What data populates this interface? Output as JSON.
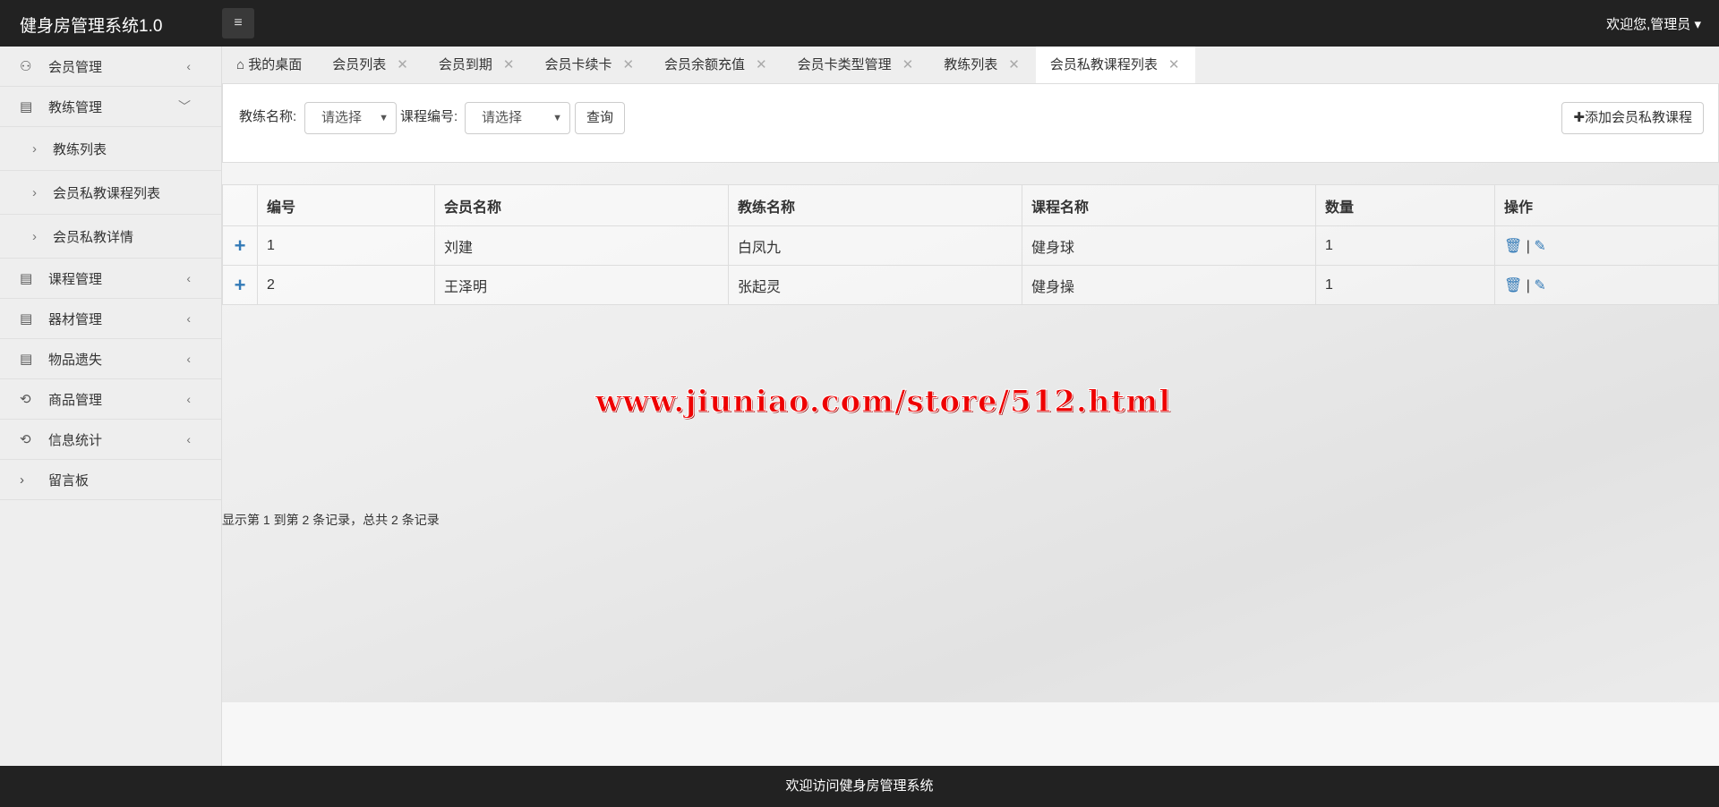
{
  "header": {
    "title": "健身房管理系统1.0",
    "user": "欢迎您,管理员",
    "menu_icon": "≡"
  },
  "sidebar": {
    "items": [
      {
        "label": "会员管理",
        "icon": "user-icon",
        "arrow": "‹"
      },
      {
        "label": "教练管理",
        "icon": "doc-icon",
        "arrow": "⌄",
        "expanded": true,
        "children": [
          {
            "label": "教练列表"
          },
          {
            "label": "会员私教课程列表"
          },
          {
            "label": "会员私教详情"
          }
        ]
      },
      {
        "label": "课程管理",
        "icon": "doc-icon",
        "arrow": "‹"
      },
      {
        "label": "器材管理",
        "icon": "doc-icon",
        "arrow": "‹"
      },
      {
        "label": "物品遗失",
        "icon": "doc-icon",
        "arrow": "‹"
      },
      {
        "label": "商品管理",
        "icon": "cycle-icon",
        "arrow": "‹"
      },
      {
        "label": "信息统计",
        "icon": "cycle-icon",
        "arrow": "‹"
      },
      {
        "label": "留言板",
        "icon": "chevron-icon"
      }
    ]
  },
  "tabs": [
    {
      "label": "我的桌面"
    },
    {
      "label": "会员列表"
    },
    {
      "label": "会员到期"
    },
    {
      "label": "会员卡续卡"
    },
    {
      "label": "会员余额充值"
    },
    {
      "label": "会员卡类型管理"
    },
    {
      "label": "教练列表"
    },
    {
      "label": "会员私教课程列表",
      "active": true
    }
  ],
  "filter": {
    "coach_label": "教练名称:",
    "coach_value": "请选择",
    "course_label": "课程编号:",
    "course_value": "请选择",
    "query": "查询",
    "add": "添加会员私教课程"
  },
  "table": {
    "headers": [
      "编号",
      "会员名称",
      "教练名称",
      "课程名称",
      "数量",
      "操作"
    ],
    "rows": [
      [
        "1",
        "刘建",
        "白凤九",
        "健身球",
        "1"
      ],
      [
        "2",
        "王泽明",
        "张起灵",
        "健身操",
        "1"
      ]
    ]
  },
  "pagination": "显示第 1 到第 2 条记录，总共 2 条记录",
  "watermark": "www.jiuniao.com/store/512.html",
  "footer": "欢迎访问健身房管理系统"
}
